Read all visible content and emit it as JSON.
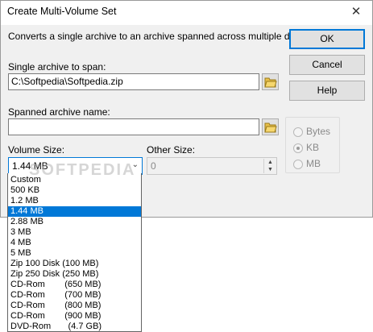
{
  "window": {
    "title": "Create Multi-Volume Set",
    "close_glyph": "✕",
    "description": "Converts a single archive to an archive spanned across multiple disks."
  },
  "buttons": {
    "ok": "OK",
    "cancel": "Cancel",
    "help": "Help"
  },
  "fields": {
    "single_archive_label": "Single archive to span:",
    "single_archive_value": "C:\\Softpedia\\Softpedia.zip",
    "spanned_name_label": "Spanned archive name:",
    "spanned_name_value": "",
    "volume_size_label": "Volume Size:",
    "volume_size_value": "1.44 MB",
    "other_size_label": "Other Size:",
    "other_size_value": "0"
  },
  "units": {
    "bytes": "Bytes",
    "kb": "KB",
    "mb": "MB",
    "selected": "KB"
  },
  "volume_options": [
    "Custom",
    "500 KB",
    "1.2 MB",
    "1.44 MB",
    "2.88 MB",
    "3 MB",
    "4 MB",
    "5 MB",
    "Zip 100 Disk (100 MB)",
    "Zip 250 Disk (250 MB)",
    "CD-Rom        (650 MB)",
    "CD-Rom        (700 MB)",
    "CD-Rom        (800 MB)",
    "CD-Rom        (900 MB)",
    "DVD-Rom       (4.7 GB)"
  ],
  "selected_option_index": 3,
  "watermark": "SOFTPEDIA",
  "icons": {
    "folder": "open-folder-icon",
    "chevron": "chevron-down-icon"
  },
  "colors": {
    "accent": "#0078d7",
    "dialog_bg": "#f0f0f0"
  }
}
